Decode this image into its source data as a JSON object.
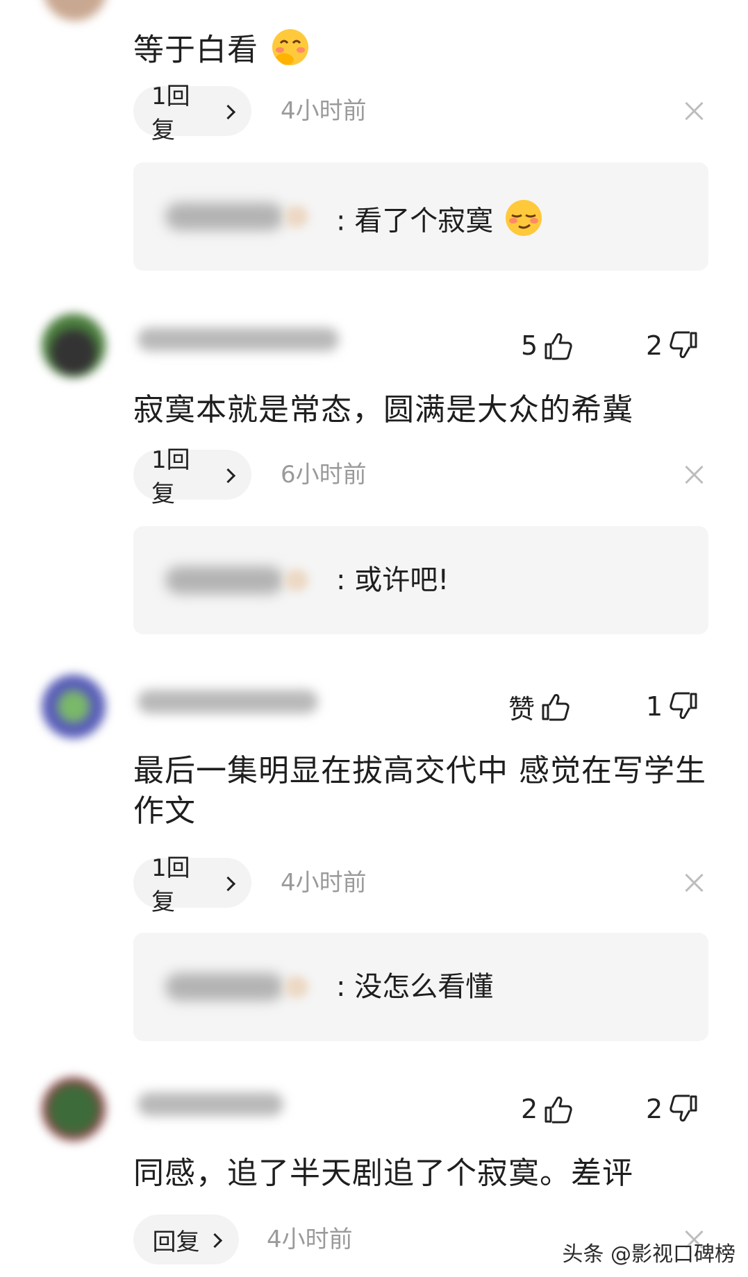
{
  "comments": [
    {
      "text": "等于白看",
      "emoji": "shy-smile-emoji",
      "reply_label": "1回复",
      "time": "4小时前",
      "sub_reply": {
        "text": "看了个寂寞",
        "emoji": "smug-face-emoji"
      }
    },
    {
      "likes": "5",
      "dislikes": "2",
      "text": "寂寞本就是常态，圆满是大众的希冀",
      "reply_label": "1回复",
      "time": "6小时前",
      "sub_reply": {
        "text": "或许吧!"
      }
    },
    {
      "likes": "赞",
      "dislikes": "1",
      "text": "最后一集明显在拔高交代中 感觉在写学生作文",
      "reply_label": "1回复",
      "time": "4小时前",
      "sub_reply": {
        "text": "没怎么看懂"
      }
    },
    {
      "likes": "2",
      "dislikes": "2",
      "text": "同感，追了半天剧追了个寂寞。差评",
      "reply_label": "回复",
      "time": "4小时前"
    }
  ],
  "watermark": "头条 @影视口碑榜",
  "sub_prefix": ":",
  "icons": {
    "like": "thumbs-up-icon",
    "dislike": "thumbs-down-icon",
    "close": "close-icon",
    "chevron": "chevron-right-icon"
  }
}
